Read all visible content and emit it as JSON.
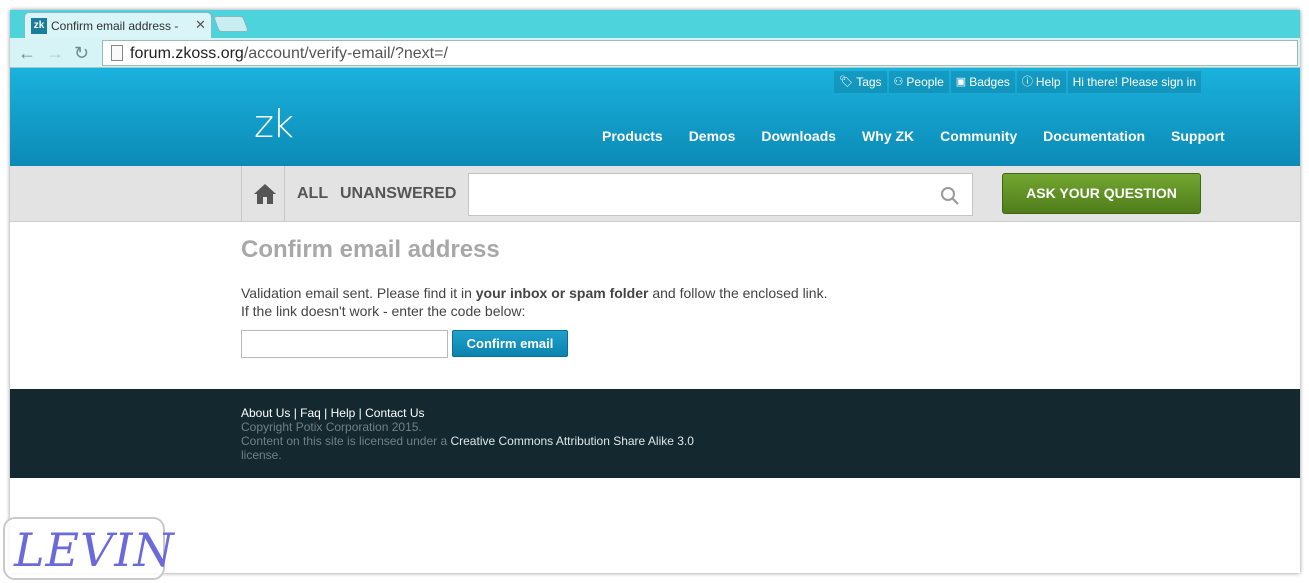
{
  "browser": {
    "tab_title": "Confirm email address -",
    "tab_favicon": "zk",
    "url_host": "forum.zkoss.org",
    "url_path": "/account/verify-email/?next=/"
  },
  "header": {
    "logo_text": "zk",
    "topbar": [
      {
        "icon": "tag-icon",
        "label": "Tags"
      },
      {
        "icon": "people-icon",
        "label": "People"
      },
      {
        "icon": "badge-icon",
        "label": "Badges"
      },
      {
        "icon": "info-icon",
        "label": "Help"
      },
      {
        "icon": "",
        "label": "Hi there! Please sign in"
      }
    ],
    "nav": [
      "Products",
      "Demos",
      "Downloads",
      "Why ZK",
      "Community",
      "Documentation",
      "Support"
    ]
  },
  "search": {
    "filter_all": "ALL",
    "filter_unanswered": "UNANSWERED",
    "ask_button": "ASK YOUR QUESTION"
  },
  "main": {
    "title": "Confirm email address",
    "msg_before": "Validation email sent. Please find it in ",
    "msg_bold": "your inbox or spam folder",
    "msg_after": " and follow the enclosed link.",
    "msg_line2": "If the link doesn't work - enter the code below:",
    "code_value": "",
    "confirm_button": "Confirm email"
  },
  "footer": {
    "link_about": "About Us",
    "link_faq": "Faq",
    "link_help": "Help",
    "link_contact": "Contact Us",
    "separator": " | ",
    "copyright": "Copyright Potix Corporation 2015.",
    "license_prefix": "Content on this site is licensed under a ",
    "license_link": "Creative Commons Attribution Share Alike 3.0",
    "license_suffix": "license."
  },
  "watermark": {
    "text": "LEVIN"
  },
  "colors": {
    "header_top": "#1ab2dc",
    "header_bottom": "#0a86b3",
    "ask_button": "#5f911f",
    "confirm_button": "#1193bf",
    "footer_bg": "#13282f"
  }
}
